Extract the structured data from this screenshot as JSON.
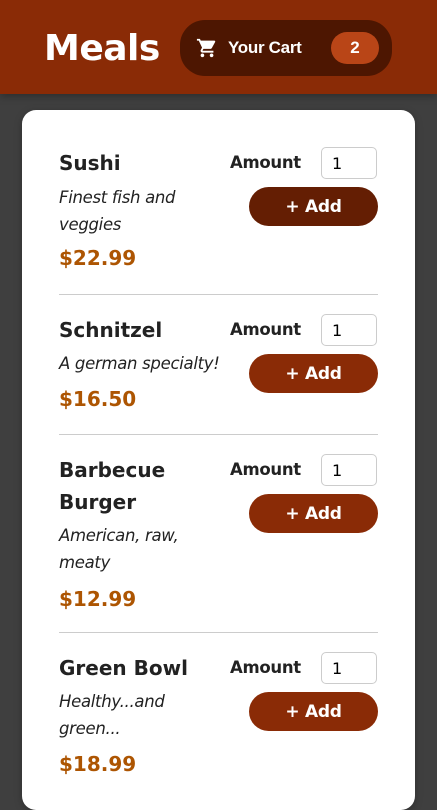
{
  "header": {
    "title": "Meals",
    "cart": {
      "label": "Your Cart",
      "count": "2",
      "icon": "cart-icon"
    }
  },
  "meals": [
    {
      "name": "Sushi",
      "description": "Finest fish and veggies",
      "price": "$22.99",
      "amount_label": "Amount",
      "amount": "1",
      "add_label": "+ Add"
    },
    {
      "name": "Schnitzel",
      "description": "A german specialty!",
      "price": "$16.50",
      "amount_label": "Amount",
      "amount": "1",
      "add_label": "+ Add"
    },
    {
      "name": "Barbecue Burger",
      "description": "American, raw, meaty",
      "price": "$12.99",
      "amount_label": "Amount",
      "amount": "1",
      "add_label": "+ Add"
    },
    {
      "name": "Green Bowl",
      "description": "Healthy...and green...",
      "price": "$18.99",
      "amount_label": "Amount",
      "amount": "1",
      "add_label": "+ Add"
    }
  ],
  "colors": {
    "header_bg": "#8a2b06",
    "cart_button_bg": "#4d1601",
    "badge_bg": "#b94517",
    "price": "#ad5502",
    "page_bg": "#3f3f3f"
  }
}
